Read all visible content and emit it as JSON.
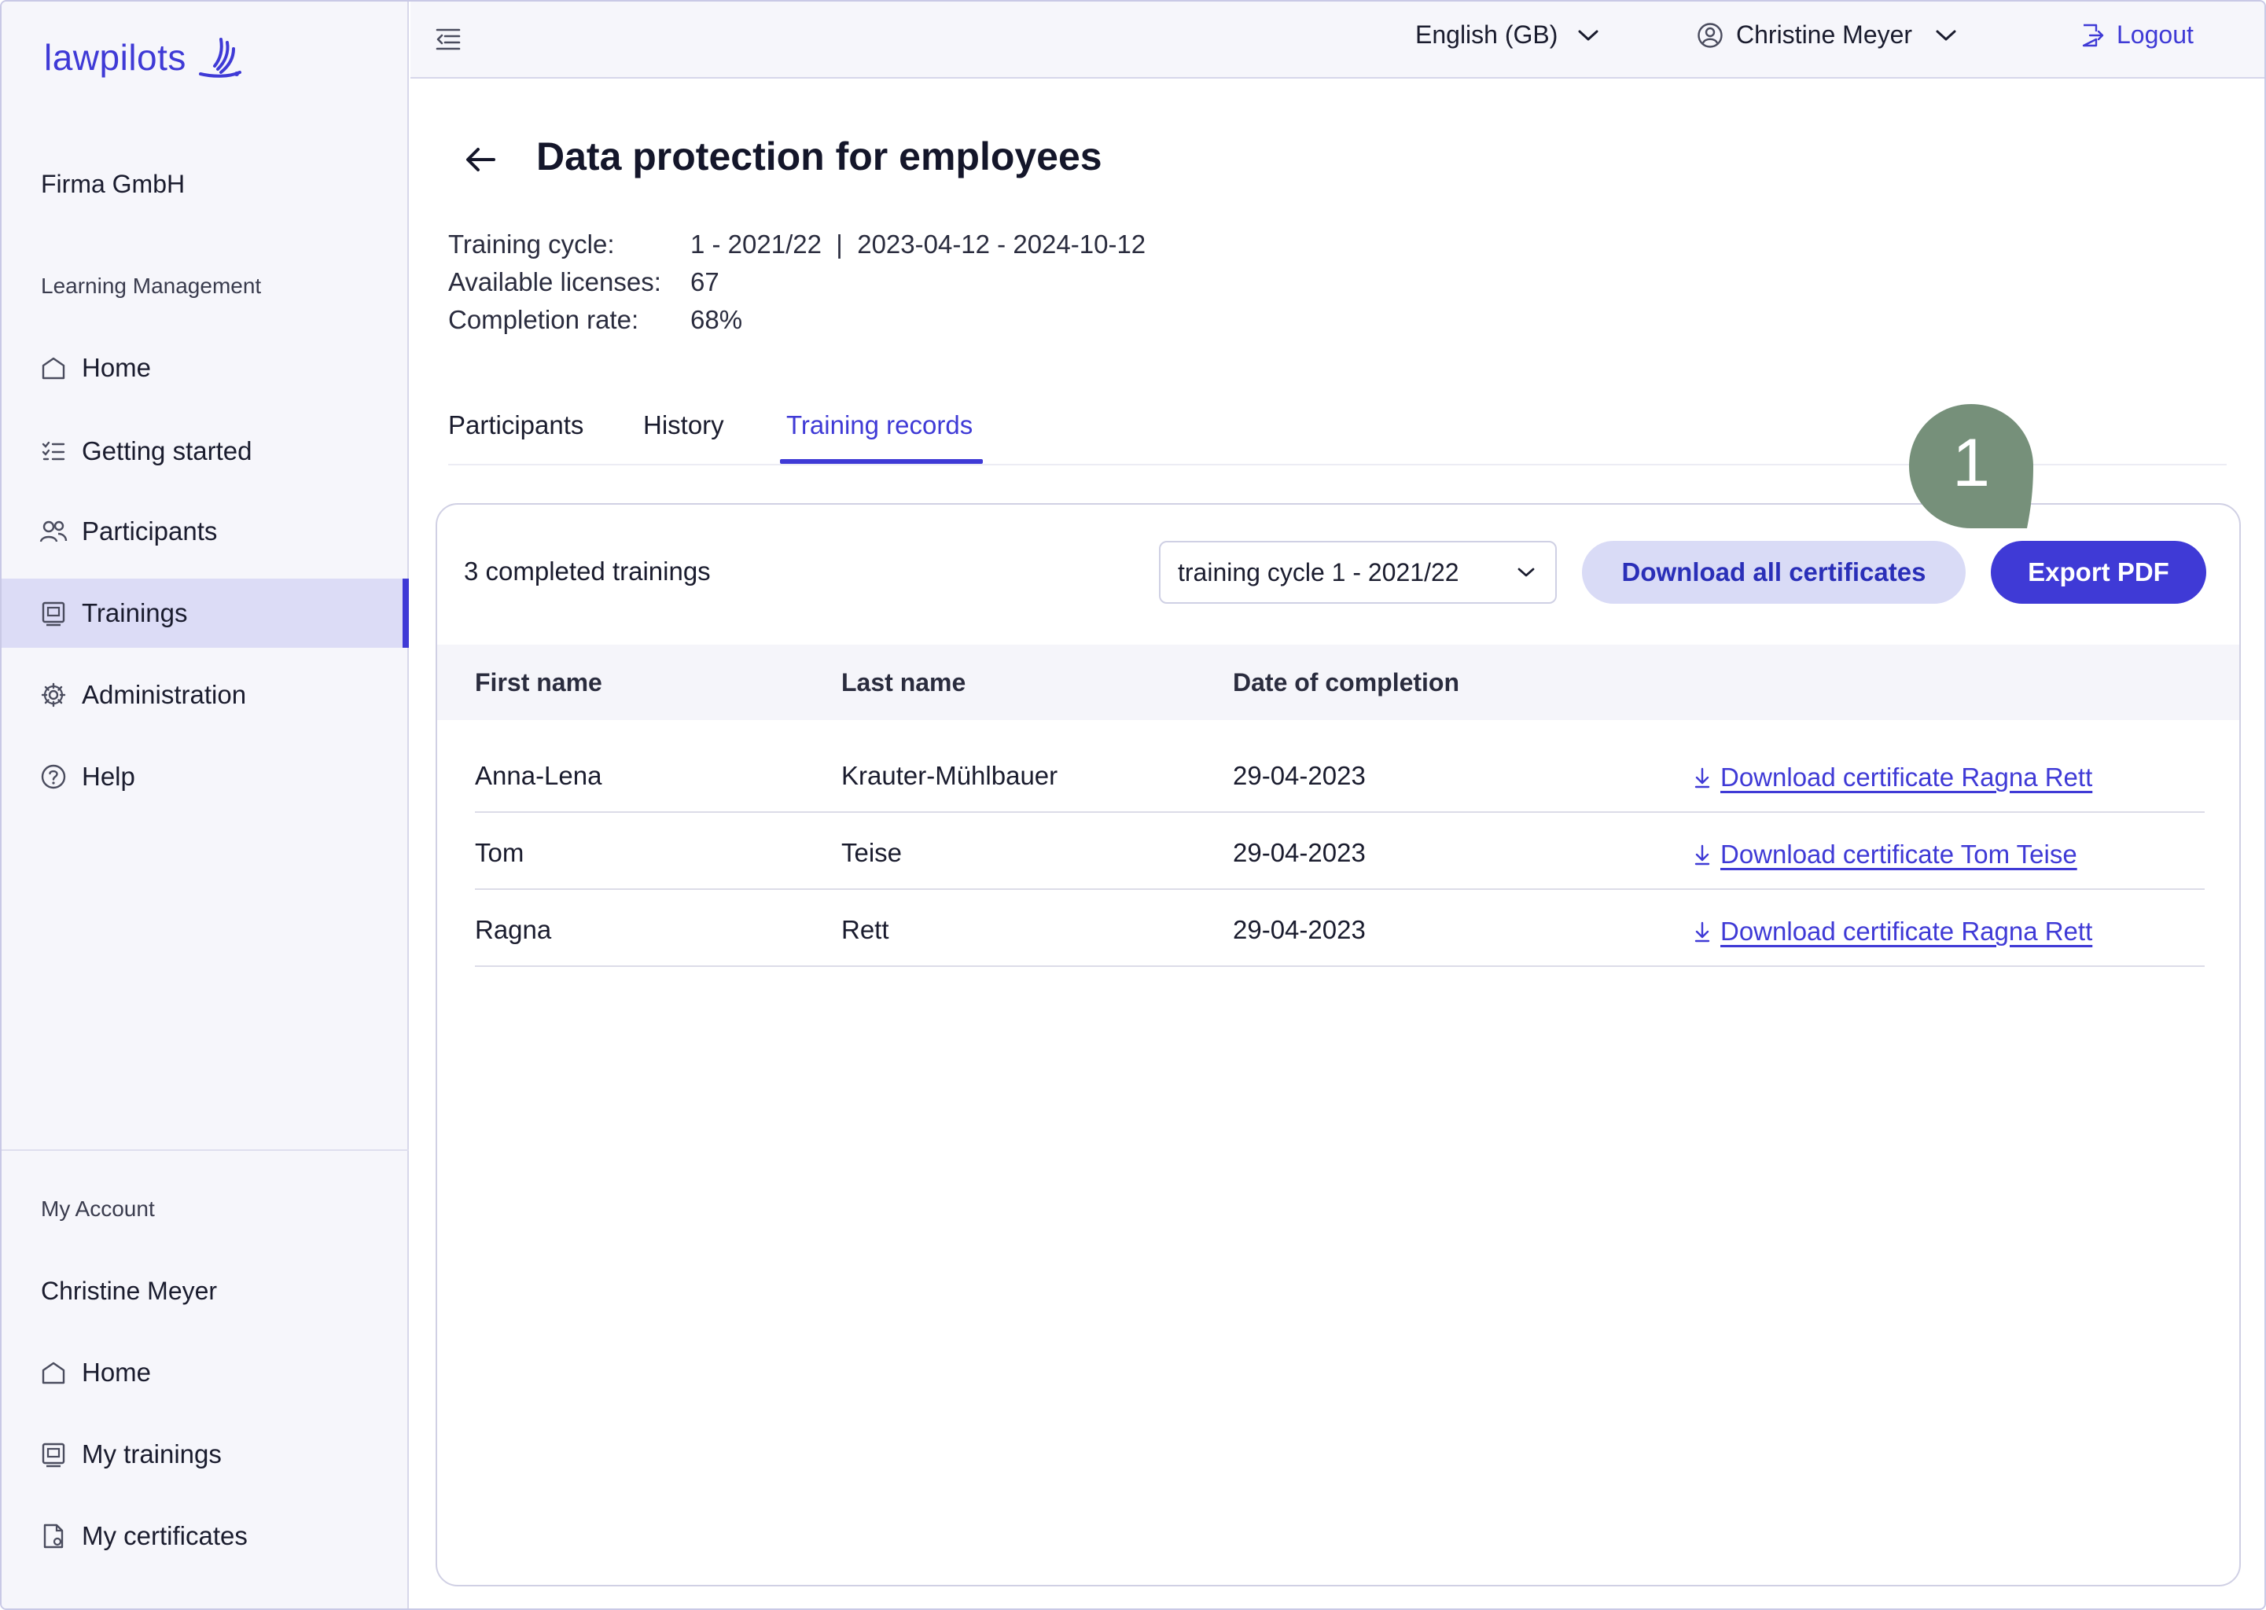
{
  "brand": {
    "name": "lawpilots",
    "accent": "#3f3ad6"
  },
  "sidebar": {
    "org": "Firma GmbH",
    "section_label": "Learning Management",
    "items": [
      {
        "label": "Home",
        "icon": "home-icon"
      },
      {
        "label": "Getting started",
        "icon": "checklist-icon"
      },
      {
        "label": "Participants",
        "icon": "users-icon"
      },
      {
        "label": "Trainings",
        "icon": "training-icon",
        "active": true
      },
      {
        "label": "Administration",
        "icon": "gear-icon"
      },
      {
        "label": "Help",
        "icon": "help-icon"
      }
    ],
    "account_label": "My Account",
    "account_name": "Christine Meyer",
    "account_items": [
      {
        "label": "Home",
        "icon": "home-icon"
      },
      {
        "label": "My trainings",
        "icon": "training-icon"
      },
      {
        "label": "My certificates",
        "icon": "certificate-icon"
      }
    ]
  },
  "topbar": {
    "language": "English (GB)",
    "user": "Christine Meyer",
    "logout": "Logout"
  },
  "page": {
    "title": "Data protection for employees",
    "meta": {
      "cycle_label": "Training cycle:",
      "cycle_value": "1 - 2021/22  |  2023-04-12 - 2024-10-12",
      "licenses_label": "Available licenses:",
      "licenses_value": "67",
      "completion_label": "Completion rate:",
      "completion_value": "68%"
    },
    "tabs": [
      {
        "label": "Participants"
      },
      {
        "label": "History"
      },
      {
        "label": "Training records",
        "active": true
      }
    ]
  },
  "records": {
    "count_text": "3 completed trainings",
    "cycle_select": "training cycle 1 - 2021/22",
    "download_all": "Download all certificates",
    "export_pdf": "Export PDF",
    "columns": [
      "First name",
      "Last name",
      "Date of completion"
    ],
    "rows": [
      {
        "first": "Anna-Lena",
        "last": "Krauter-Mühlbauer",
        "date": "29-04-2023",
        "link": "Download certificate Ragna Rett"
      },
      {
        "first": "Tom",
        "last": "Teise",
        "date": "29-04-2023",
        "link": "Download certificate Tom Teise"
      },
      {
        "first": "Ragna",
        "last": "Rett",
        "date": "29-04-2023",
        "link": "Download certificate Ragna Rett"
      }
    ]
  },
  "marker": {
    "number": "1",
    "color": "#76907a"
  }
}
